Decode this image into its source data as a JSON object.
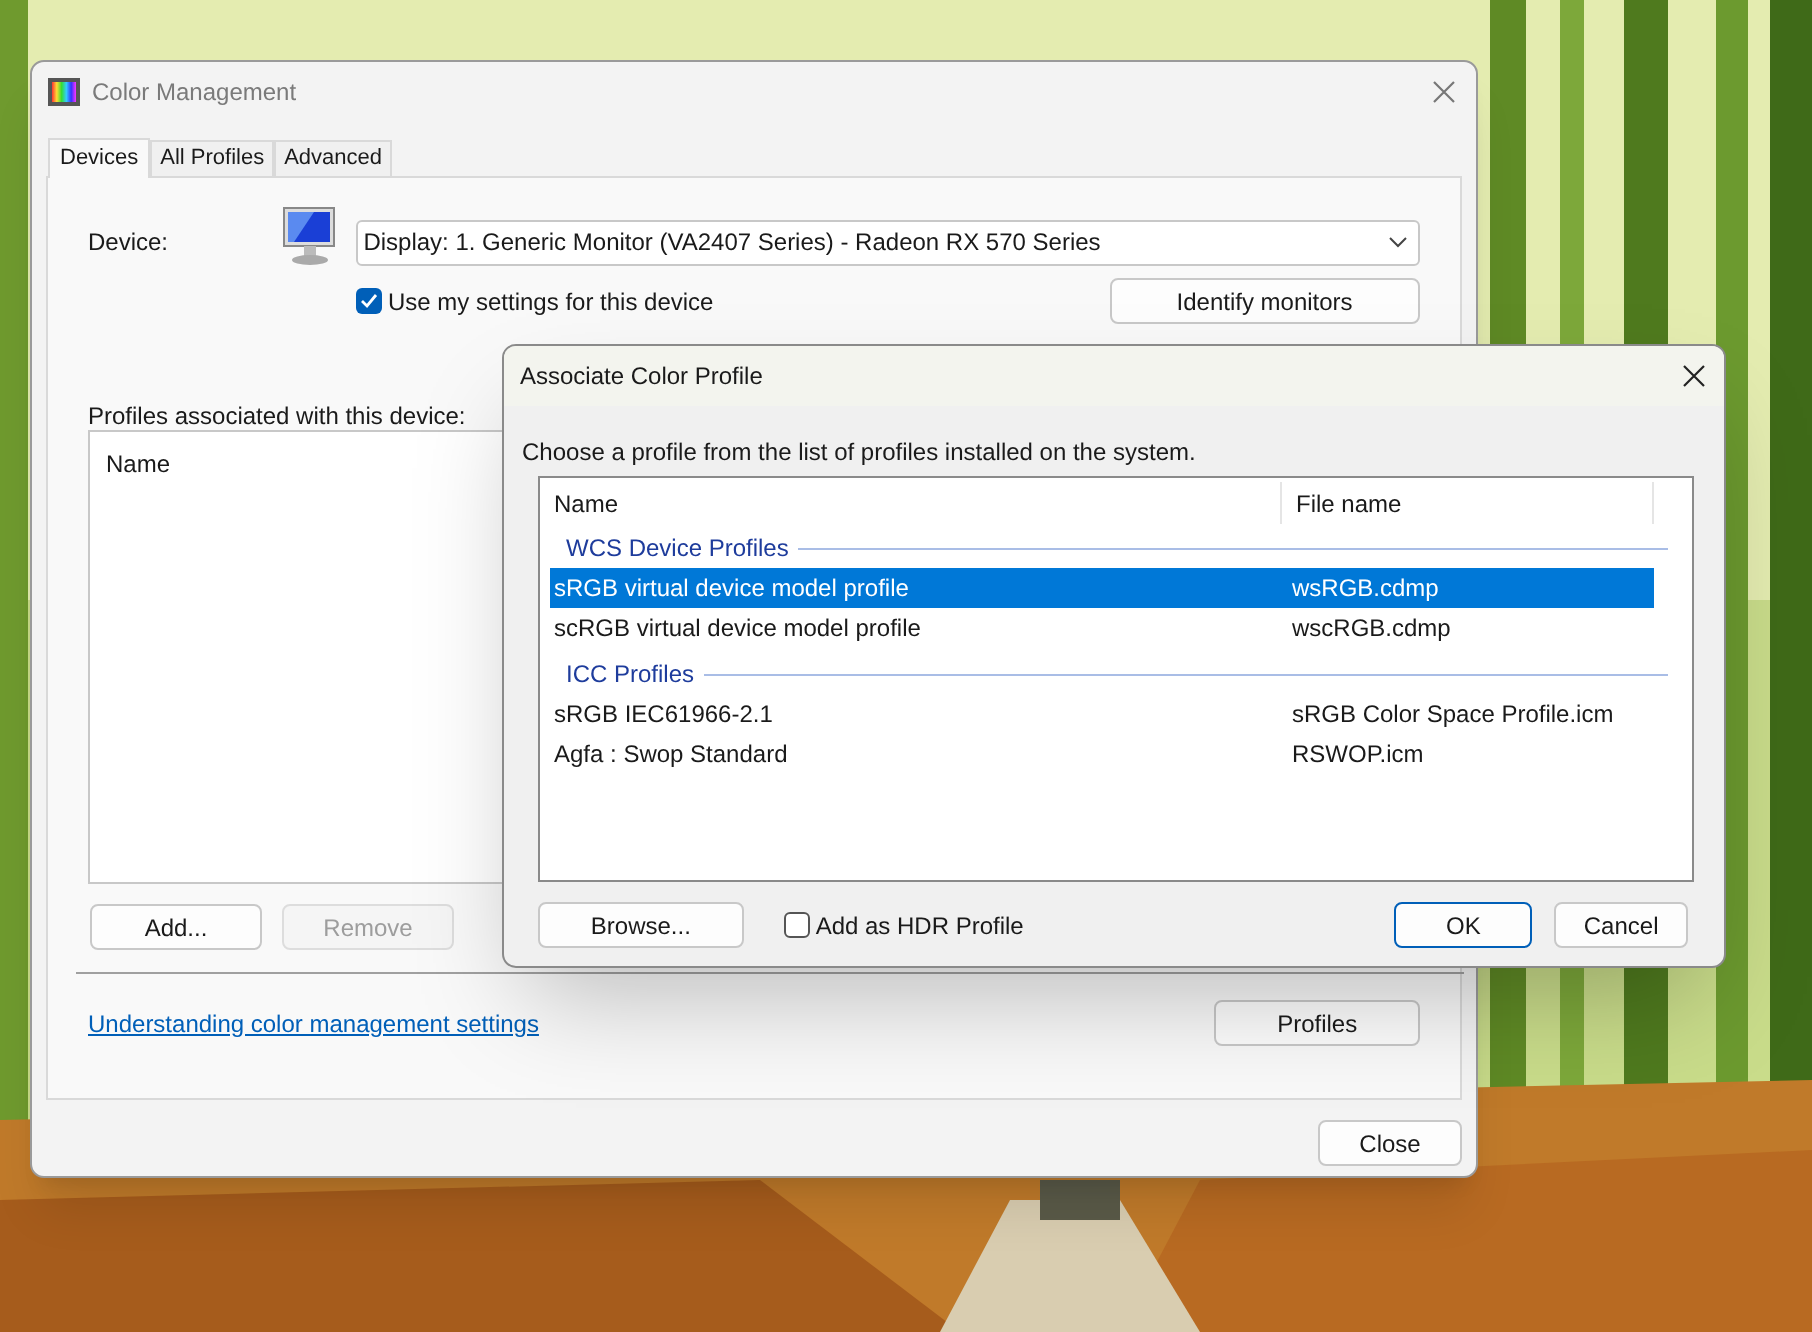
{
  "main_window": {
    "title": "Color Management",
    "tabs": [
      {
        "label": "Devices",
        "selected": true
      },
      {
        "label": "All Profiles",
        "selected": false
      },
      {
        "label": "Advanced",
        "selected": false
      }
    ],
    "device_label": "Device:",
    "device_value": "Display: 1. Generic Monitor (VA2407 Series) - Radeon RX 570 Series",
    "use_my_settings": {
      "label": "Use my settings for this device",
      "checked": true
    },
    "identify_button": "Identify monitors",
    "profiles_label": "Profiles associated with this device:",
    "profiles_columns": [
      "Name"
    ],
    "add_button": {
      "label": "Add...",
      "disabled": false
    },
    "remove_button": {
      "label": "Remove",
      "disabled": true
    },
    "help_link": "Understanding color management settings",
    "profiles_button": "Profiles",
    "close_button": "Close"
  },
  "dialog": {
    "title": "Associate Color Profile",
    "instruction": "Choose a profile from the list of profiles installed on the system.",
    "columns": [
      "Name",
      "File name"
    ],
    "groups": [
      {
        "label": "WCS Device Profiles",
        "rows": [
          {
            "name": "sRGB virtual device model profile",
            "file": "wsRGB.cdmp",
            "selected": true
          },
          {
            "name": "scRGB virtual device model profile",
            "file": "wscRGB.cdmp",
            "selected": false
          }
        ]
      },
      {
        "label": "ICC Profiles",
        "rows": [
          {
            "name": "sRGB IEC61966-2.1",
            "file": "sRGB Color Space Profile.icm",
            "selected": false
          },
          {
            "name": "Agfa : Swop Standard",
            "file": "RSWOP.icm",
            "selected": false
          }
        ]
      }
    ],
    "browse_button": "Browse...",
    "hdr_checkbox": {
      "label": "Add as HDR Profile",
      "checked": false
    },
    "ok_button": "OK",
    "cancel_button": "Cancel"
  }
}
